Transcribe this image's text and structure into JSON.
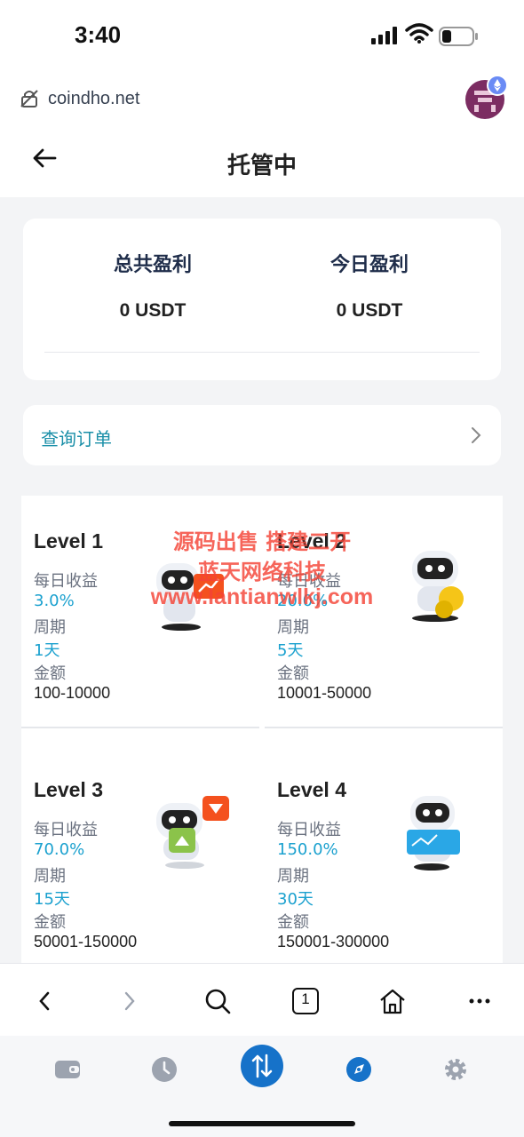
{
  "status_bar": {
    "time": "3:40"
  },
  "browser": {
    "url": "coindho.net"
  },
  "page": {
    "title": "托管中"
  },
  "profit": {
    "total_label": "总共盈利",
    "total_value": "0 USDT",
    "today_label": "今日盈利",
    "today_value": "0 USDT"
  },
  "query": {
    "label": "查询订单"
  },
  "levels": [
    {
      "name": "Level 1",
      "daily_label": "每日收益",
      "daily": "3.0%",
      "period_label": "周期",
      "period": "1天",
      "amount_label": "金额",
      "amount": "100-10000"
    },
    {
      "name": "Level 2",
      "daily_label": "每日收益",
      "daily": "20.0%",
      "period_label": "周期",
      "period": "5天",
      "amount_label": "金额",
      "amount": "10001-50000"
    },
    {
      "name": "Level 3",
      "daily_label": "每日收益",
      "daily": "70.0%",
      "period_label": "周期",
      "period": "15天",
      "amount_label": "金额",
      "amount": "50001-150000"
    },
    {
      "name": "Level 4",
      "daily_label": "每日收益",
      "daily": "150.0%",
      "period_label": "周期",
      "period": "30天",
      "amount_label": "金额",
      "amount": "150001-300000"
    }
  ],
  "watermark": {
    "line1": "源码出售 搭建二开",
    "line2": "蓝天网络科技",
    "line3": "www.lantianwlkj.com"
  },
  "browser_nav": {
    "tabs_count": "1"
  },
  "colors": {
    "accent": "#1ba1cf",
    "tab_active": "#1672c9",
    "watermark": "#f44336"
  }
}
